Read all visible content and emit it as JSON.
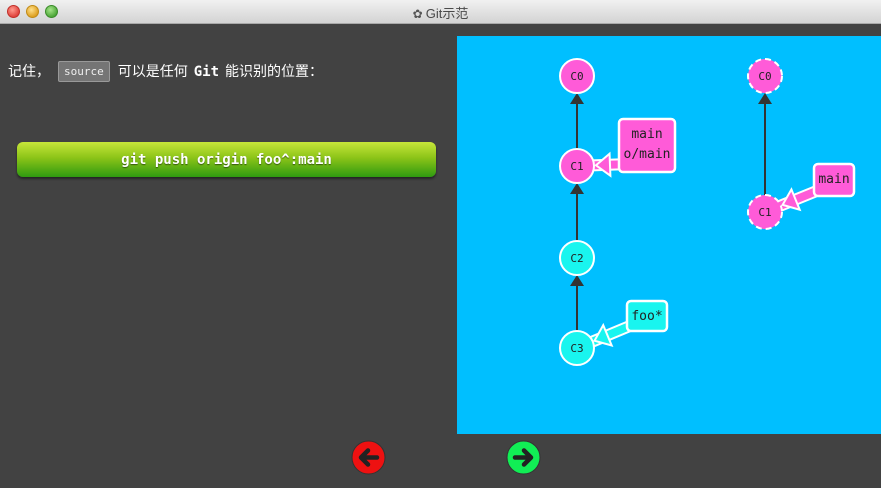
{
  "window": {
    "title": "Git示范"
  },
  "instruction": {
    "prefix": "记住，",
    "code": "source",
    "middle": "可以是任何",
    "git": "Git",
    "suffix": "能识别的位置："
  },
  "command": {
    "text": "git push origin foo^:main"
  },
  "graph": {
    "local": {
      "commits": [
        {
          "id": "C0",
          "label": "C0",
          "color": "#ff5bd8"
        },
        {
          "id": "C1",
          "label": "C1",
          "color": "#ff5bd8"
        },
        {
          "id": "C2",
          "label": "C2",
          "color": "#19f5ef"
        },
        {
          "id": "C3",
          "label": "C3",
          "color": "#19f5ef"
        }
      ],
      "branches": [
        {
          "label_lines": [
            "main",
            "o/main"
          ],
          "target": "C1",
          "color": "#ff5bd8"
        },
        {
          "label_lines": [
            "foo*"
          ],
          "target": "C3",
          "color": "#19f5ef"
        }
      ]
    },
    "remote": {
      "commits": [
        {
          "id": "C0",
          "label": "C0",
          "color": "#ff5bd8"
        },
        {
          "id": "C1",
          "label": "C1",
          "color": "#ff5bd8"
        }
      ],
      "branches": [
        {
          "label_lines": [
            "main"
          ],
          "target": "C1",
          "color": "#ff5bd8"
        }
      ]
    }
  },
  "colors": {
    "background": "#424242",
    "canvas": "#00bfff",
    "back_arrow": "#ee1111",
    "forward_arrow": "#11ee55"
  },
  "nav": {
    "back_icon": "arrow-left-icon",
    "forward_icon": "arrow-right-icon"
  }
}
